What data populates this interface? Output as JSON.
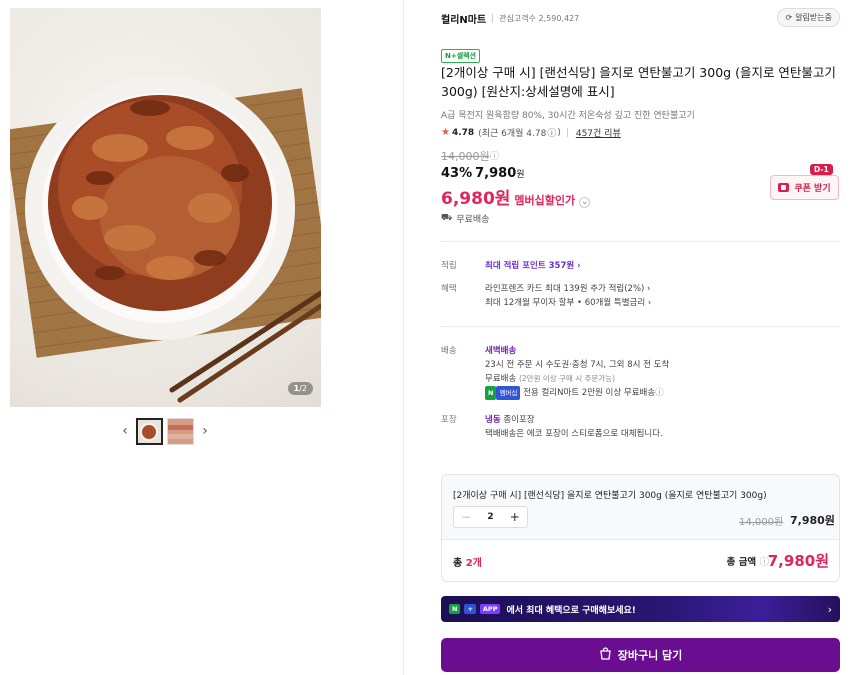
{
  "gallery": {
    "pager_current": "1",
    "pager_total": "2",
    "pager_sep": "/"
  },
  "seller": {
    "name": "컬리N마트",
    "fans_label": "관심고객수 2,590,427",
    "notify_label": "알림받는중"
  },
  "badge": "N+셀렉션",
  "product": {
    "title": "[2개이상 구매 시] [랜선식당] 을지로 연탄불고기 300g (을지로 연탄불고기 300g) [원산지:상세설명에 표시]",
    "subtitle": "A급 목전지 원육함량 80%, 30시간 저온숙성 깊고 진한 연탄불고기",
    "rating": "4.78",
    "rating_recent": "(최근 6개월 4.78",
    "reviews": "457건 리뷰",
    "original_price": "14,000원",
    "discount": "43%",
    "sale_price": "7,980",
    "won": "원",
    "member_price": "6,980원",
    "member_label": "멤버십할인가",
    "shipping": "무료배송"
  },
  "coupon": {
    "label": "쿠폰 받기",
    "dday": "D-1"
  },
  "info": {
    "points_label": "적립",
    "points_value": "최대 적립 포인트 357원",
    "benefit_label": "혜택",
    "benefit_line1": "라인프렌즈 카드 최대 139원 추가 적립(2%)",
    "benefit_line2": "최대 12개월 무이자 할부 • 60개월 특별금리",
    "delivery_label": "배송",
    "delivery_type": "새벽배송",
    "delivery_line1": "23시 전 주문 시 수도권·충청 7시, 그외 8시 전 도착",
    "delivery_line2_main": "무료배송",
    "delivery_line2_sub": "(2만원 이상 구매 시 주문가능)",
    "delivery_badge_n": "N",
    "delivery_badge_member": "멤버십",
    "delivery_line3": "전용 컬리N마트 2만원 이상 무료배송",
    "packing_label": "포장",
    "packing_type": "냉동",
    "packing_material": "종이포장",
    "packing_note": "택배배송은 에코 포장이 스티로폼으로 대체됩니다."
  },
  "buybox": {
    "name": "[2개이상 구매 시] [랜선식당] 을지로 연탄불고기 300g (을지로 연탄불고기 300g)",
    "qty": "2",
    "orig_price": "14,000원",
    "sale_price": "7,980원",
    "total_prefix": "총",
    "total_count": "2개",
    "total_label": "총 금액",
    "total_price": "7,980원"
  },
  "app_banner": {
    "tag_n": "N",
    "tag_plus": "+",
    "tag_app": "APP",
    "text": "에서 최대 혜택으로 구매해보세요!"
  },
  "cart_button": "장바구니 담기",
  "colors": {
    "brand_purple": "#6a0d90",
    "price_red": "#e0245e",
    "points_purple": "#6b2fd8"
  }
}
